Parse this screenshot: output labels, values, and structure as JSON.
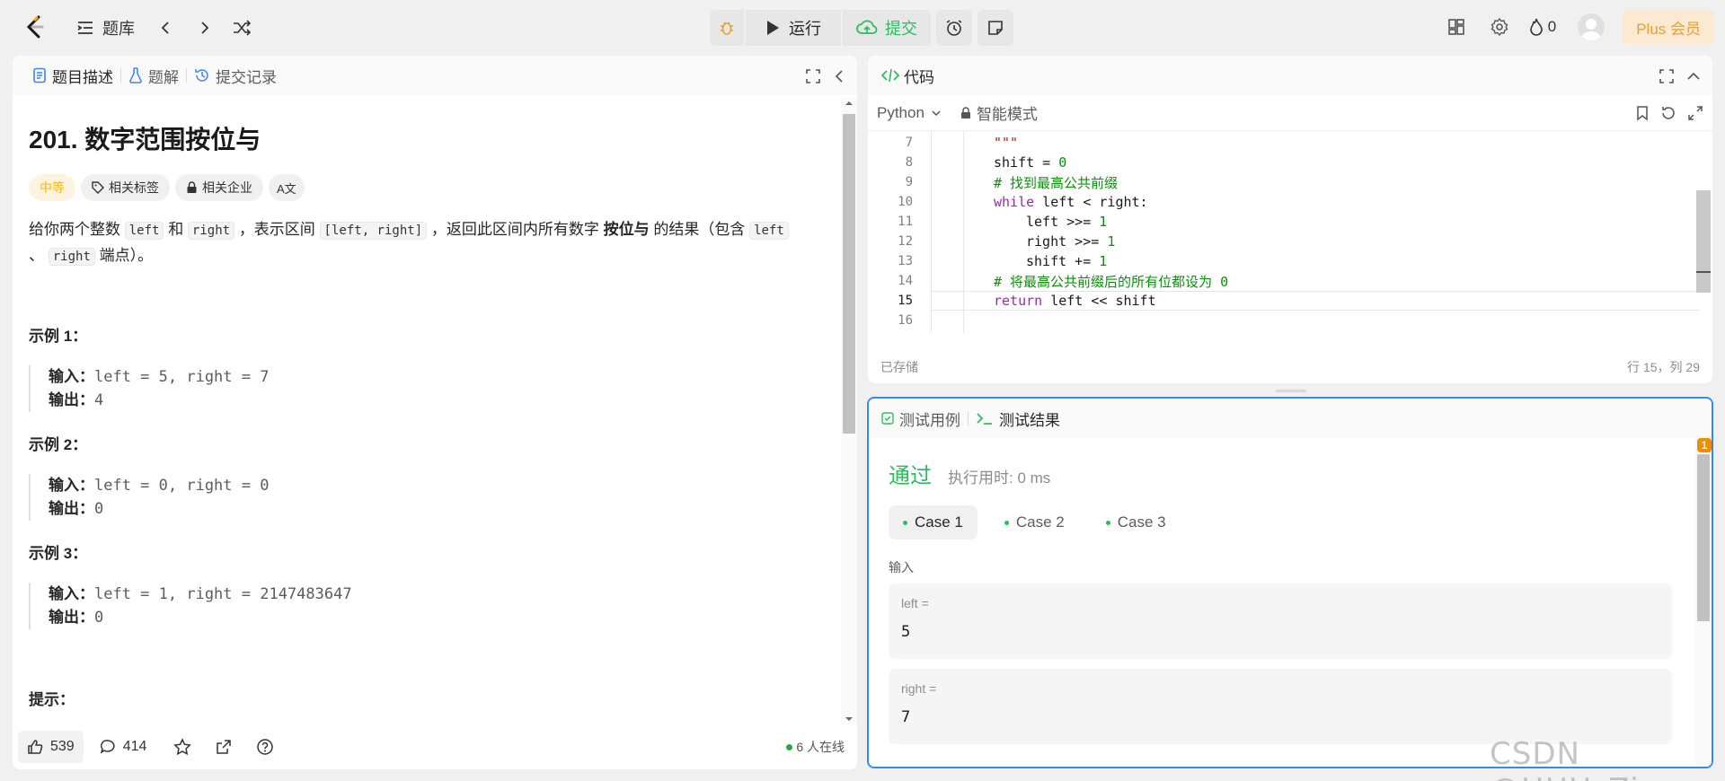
{
  "topbar": {
    "problem_list_label": "题库",
    "run_label": "运行",
    "submit_label": "提交",
    "streak_count": "0",
    "plus_label": "Plus 会员"
  },
  "left_panel": {
    "tabs": [
      {
        "label": "题目描述"
      },
      {
        "label": "题解"
      },
      {
        "label": "提交记录"
      }
    ],
    "title": "201. 数字范围按位与",
    "tags": {
      "difficulty": "中等",
      "related_tags": "相关标签",
      "related_companies": "相关企业",
      "translate_glyph": "A文"
    },
    "desc": {
      "p1": "给你两个整数",
      "c1": "left",
      "p2": "和",
      "c2": "right",
      "p3": "，表示区间",
      "c3": "[left, right]",
      "p4": "，返回此区间内所有数字",
      "bold": "按位与",
      "p5": "的结果（包含",
      "c4": "left",
      "p6": "、",
      "c5": "right",
      "p7": "端点）。"
    },
    "input_label": "输入：",
    "output_label": "输出：",
    "examples": [
      {
        "heading": "示例 1：",
        "input": "left = 5, right = 7",
        "output": "4"
      },
      {
        "heading": "示例 2：",
        "input": "left = 0, right = 0",
        "output": "0"
      },
      {
        "heading": "示例 3：",
        "input": "left = 1, right = 2147483647",
        "output": "0"
      }
    ],
    "hints_heading": "提示：",
    "footer": {
      "likes": "539",
      "comments": "414",
      "online": "6 人在线"
    }
  },
  "code_panel": {
    "title": "代码",
    "language": "Python",
    "mode": "智能模式",
    "lines": [
      {
        "n": "7",
        "text": "\"\"\""
      },
      {
        "n": "8",
        "text": "shift = 0"
      },
      {
        "n": "9",
        "text": "# 找到最高公共前缀"
      },
      {
        "n": "10",
        "text": "while left < right:"
      },
      {
        "n": "11",
        "text": "left >>= 1"
      },
      {
        "n": "12",
        "text": "right >>= 1"
      },
      {
        "n": "13",
        "text": "shift += 1"
      },
      {
        "n": "14",
        "text": "# 将最高公共前缀后的所有位都设为 0"
      },
      {
        "n": "15",
        "text": "return left << shift"
      },
      {
        "n": "16",
        "text": ""
      }
    ],
    "saved": "已存储",
    "cursor_pos": "行 15，列 29"
  },
  "result_panel": {
    "tab_testcase": "测试用例",
    "tab_result": "测试结果",
    "status": "通过",
    "runtime": "执行用时: 0 ms",
    "cases": [
      "Case 1",
      "Case 2",
      "Case 3"
    ],
    "input_heading": "输入",
    "params": [
      {
        "name": "left =",
        "value": "5"
      },
      {
        "name": "right =",
        "value": "7"
      }
    ],
    "badge": "1"
  },
  "watermark": "CSDN @HHU_Zi",
  "colors": {
    "accent_green": "#2cbb5d",
    "focus_blue": "#2f8cf5",
    "difficulty_orange": "#ffb800",
    "plus_gold": "#e8a02f"
  }
}
